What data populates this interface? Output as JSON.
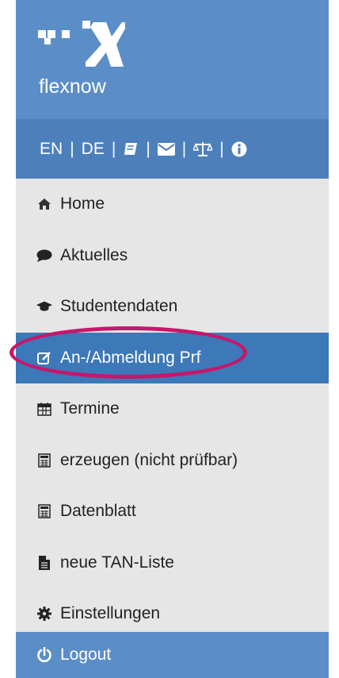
{
  "brand": {
    "name": "flexnow",
    "accent": "#5b8ec6"
  },
  "langbar": {
    "items": [
      "EN",
      "DE"
    ],
    "separator": "|",
    "icons": [
      "book-icon",
      "envelope-icon",
      "balance-scale-icon",
      "info-icon"
    ]
  },
  "nav": {
    "items": [
      {
        "label": "Home",
        "icon": "home-icon"
      },
      {
        "label": "Aktuelles",
        "icon": "comment-icon"
      },
      {
        "label": "Studentendaten",
        "icon": "graduation-cap-icon"
      },
      {
        "label": "An-/Abmeldung Prf",
        "icon": "edit-icon",
        "active": true
      },
      {
        "label": "Termine",
        "icon": "calendar-icon"
      },
      {
        "label": "erzeugen (nicht prüfbar)",
        "icon": "calculator-icon"
      },
      {
        "label": "Datenblatt",
        "icon": "calculator-icon"
      },
      {
        "label": "neue TAN-Liste",
        "icon": "file-icon"
      },
      {
        "label": "Einstellungen",
        "icon": "cog-icon"
      }
    ]
  },
  "logout": {
    "label": "Logout",
    "icon": "power-icon"
  },
  "colors": {
    "sidebar_bg": "#e6e6e6",
    "active_bg": "#3d78b8",
    "highlight": "#c8166a"
  }
}
